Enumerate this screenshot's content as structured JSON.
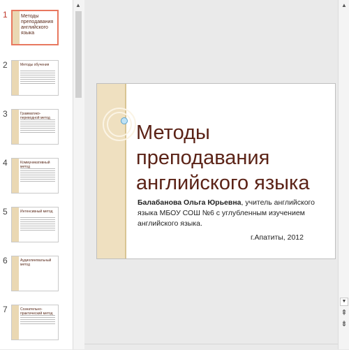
{
  "slides": [
    {
      "num": "1",
      "title": "Методы преподавания английского языка"
    },
    {
      "num": "2",
      "title": "Методы обучения"
    },
    {
      "num": "3",
      "title": "Грамматико-переводной метод"
    },
    {
      "num": "4",
      "title": "Коммуникативный метод"
    },
    {
      "num": "5",
      "title": "Интенсивный метод"
    },
    {
      "num": "6",
      "title": "Аудиолингвальный метод"
    },
    {
      "num": "7",
      "title": "Сознательно-практический метод"
    }
  ],
  "active_slide": 1,
  "slide": {
    "title": "Методы преподавания английского языка",
    "author_name": "Балабанова Ольга Юрьевна",
    "author_rest": ", учитель английского языка МБОУ СОШ №6 с углубленным изучением английского языка.",
    "place": "г.Апатиты, 2012"
  },
  "colors": {
    "accent": "#e8785f",
    "title": "#5b2317",
    "deco": "#efe0c0"
  },
  "icons": {
    "scroll_up": "triangle-up",
    "scroll_down": "triangle-down",
    "prev_slide": "double-chevron-up",
    "next_slide": "double-chevron-down"
  }
}
